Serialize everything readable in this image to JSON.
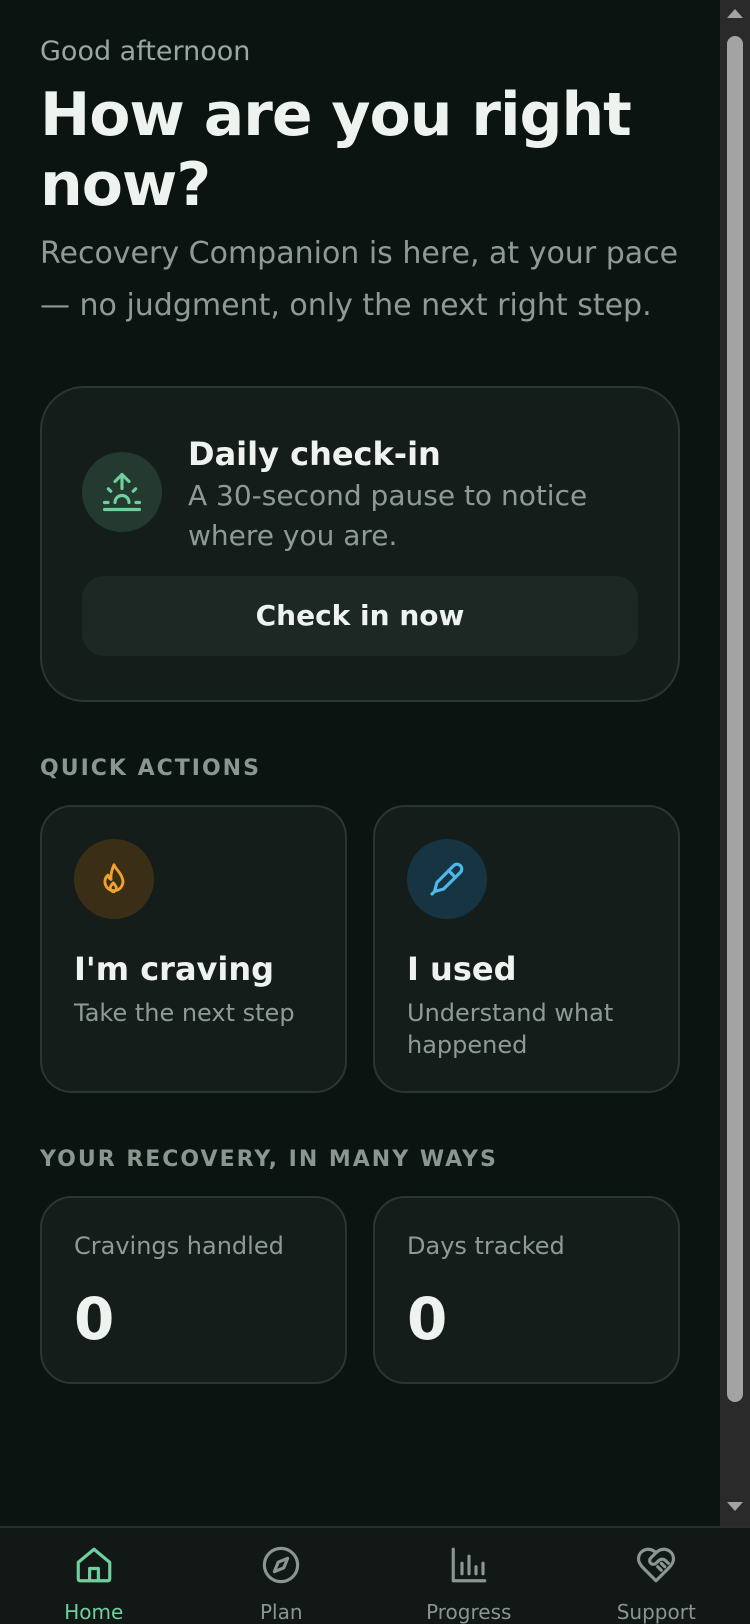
{
  "header": {
    "greeting": "Good afternoon",
    "headline_line1": "How are you right",
    "headline_line2": "now?",
    "intro": "Recovery Companion is here, at your pace — no judgment, only the next right step."
  },
  "checkin": {
    "icon": "sunrise-icon",
    "title": "Daily check-in",
    "subtitle": "A 30-second pause to notice where you are.",
    "button_label": "Check in now"
  },
  "quick_actions": {
    "label": "QUICK ACTIONS",
    "items": [
      {
        "icon": "flame-icon",
        "title": "I'm craving",
        "subtitle": "Take the next step",
        "accent": "#f0a22e"
      },
      {
        "icon": "pen-icon",
        "title": "I used",
        "subtitle": "Understand what happened",
        "accent": "#4fb8ea"
      }
    ]
  },
  "recovery": {
    "label": "YOUR RECOVERY, IN MANY WAYS",
    "stats": [
      {
        "label": "Cravings handled",
        "value": "0"
      },
      {
        "label": "Days tracked",
        "value": "0"
      }
    ]
  },
  "nav": {
    "items": [
      {
        "label": "Home",
        "icon": "home-icon",
        "active": true
      },
      {
        "label": "Plan",
        "icon": "compass-icon",
        "active": false
      },
      {
        "label": "Progress",
        "icon": "bar-chart-icon",
        "active": false
      },
      {
        "label": "Support",
        "icon": "heart-handshake-icon",
        "active": false
      }
    ]
  },
  "colors": {
    "background": "#0c1412",
    "card": "#141d1a",
    "accent_green": "#6fcf9d"
  }
}
